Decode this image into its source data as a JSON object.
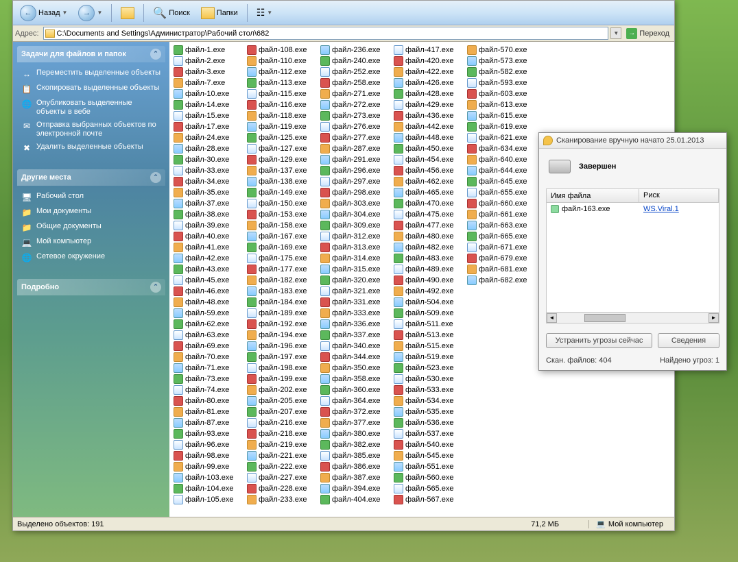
{
  "toolbar": {
    "back_label": "Назад",
    "search_label": "Поиск",
    "folders_label": "Папки"
  },
  "addressbar": {
    "label": "Адрес:",
    "path": "C:\\Documents and Settings\\Администратор\\Рабочий стол\\682",
    "go_label": "Переход"
  },
  "sidebar": {
    "panels": [
      {
        "title": "Задачи для файлов и папок",
        "items": [
          {
            "icon": "↔",
            "text": "Переместить выделенные объекты"
          },
          {
            "icon": "📋",
            "text": "Скопировать выделенные объекты"
          },
          {
            "icon": "🌐",
            "text": "Опубликовать выделенные объекты в вебе"
          },
          {
            "icon": "✉",
            "text": "Отправка выбранных объектов по электронной почте"
          },
          {
            "icon": "✖",
            "text": "Удалить выделенные объекты"
          }
        ]
      },
      {
        "title": "Другие места",
        "items": [
          {
            "icon": "🖥",
            "text": "Рабочий стол"
          },
          {
            "icon": "📁",
            "text": "Мои документы"
          },
          {
            "icon": "📁",
            "text": "Общие документы"
          },
          {
            "icon": "💻",
            "text": "Мой компьютер"
          },
          {
            "icon": "🌐",
            "text": "Сетевое окружение"
          }
        ]
      },
      {
        "title": "Подробно",
        "items": []
      }
    ]
  },
  "files": [
    "файл-1.exe",
    "файл-2.exe",
    "файл-3.exe",
    "файл-7.exe",
    "файл-10.exe",
    "файл-14.exe",
    "файл-15.exe",
    "файл-17.exe",
    "файл-24.exe",
    "файл-28.exe",
    "файл-30.exe",
    "файл-33.exe",
    "файл-34.exe",
    "файл-35.exe",
    "файл-37.exe",
    "файл-38.exe",
    "файл-39.exe",
    "файл-40.exe",
    "файл-41.exe",
    "файл-42.exe",
    "файл-43.exe",
    "файл-45.exe",
    "файл-46.exe",
    "файл-48.exe",
    "файл-59.exe",
    "файл-62.exe",
    "файл-63.exe",
    "файл-69.exe",
    "файл-70.exe",
    "файл-71.exe",
    "файл-73.exe",
    "файл-74.exe",
    "файл-80.exe",
    "файл-81.exe",
    "файл-87.exe",
    "файл-93.exe",
    "файл-96.exe",
    "файл-98.exe",
    "файл-99.exe",
    "файл-103.exe",
    "файл-104.exe",
    "файл-105.exe",
    "файл-108.exe",
    "файл-110.exe",
    "файл-112.exe",
    "файл-113.exe",
    "файл-115.exe",
    "файл-116.exe",
    "файл-118.exe",
    "файл-119.exe",
    "файл-125.exe",
    "файл-127.exe",
    "файл-129.exe",
    "файл-137.exe",
    "файл-138.exe",
    "файл-149.exe",
    "файл-150.exe",
    "файл-153.exe",
    "файл-158.exe",
    "файл-167.exe",
    "файл-169.exe",
    "файл-175.exe",
    "файл-177.exe",
    "файл-182.exe",
    "файл-183.exe",
    "файл-184.exe",
    "файл-189.exe",
    "файл-192.exe",
    "файл-194.exe",
    "файл-196.exe",
    "файл-197.exe",
    "файл-198.exe",
    "файл-199.exe",
    "файл-202.exe",
    "файл-205.exe",
    "файл-207.exe",
    "файл-216.exe",
    "файл-218.exe",
    "файл-219.exe",
    "файл-221.exe",
    "файл-222.exe",
    "файл-227.exe",
    "файл-228.exe",
    "файл-233.exe",
    "файл-236.exe",
    "файл-240.exe",
    "файл-252.exe",
    "файл-258.exe",
    "файл-271.exe",
    "файл-272.exe",
    "файл-273.exe",
    "файл-276.exe",
    "файл-277.exe",
    "файл-287.exe",
    "файл-291.exe",
    "файл-296.exe",
    "файл-297.exe",
    "файл-298.exe",
    "файл-303.exe",
    "файл-304.exe",
    "файл-309.exe",
    "файл-312.exe",
    "файл-313.exe",
    "файл-314.exe",
    "файл-315.exe",
    "файл-320.exe",
    "файл-321.exe",
    "файл-331.exe",
    "файл-333.exe",
    "файл-336.exe",
    "файл-337.exe",
    "файл-340.exe",
    "файл-344.exe",
    "файл-350.exe",
    "файл-358.exe",
    "файл-360.exe",
    "файл-364.exe",
    "файл-372.exe",
    "файл-377.exe",
    "файл-380.exe",
    "файл-382.exe",
    "файл-385.exe",
    "файл-386.exe",
    "файл-387.exe",
    "файл-394.exe",
    "файл-404.exe",
    "файл-417.exe",
    "файл-420.exe",
    "файл-422.exe",
    "файл-426.exe",
    "файл-428.exe",
    "файл-429.exe",
    "файл-436.exe",
    "файл-442.exe",
    "файл-448.exe",
    "файл-450.exe",
    "файл-454.exe",
    "файл-456.exe",
    "файл-462.exe",
    "файл-465.exe",
    "файл-470.exe",
    "файл-475.exe",
    "файл-477.exe",
    "файл-480.exe",
    "файл-482.exe",
    "файл-483.exe",
    "файл-489.exe",
    "файл-490.exe",
    "файл-492.exe",
    "файл-504.exe",
    "файл-509.exe",
    "файл-511.exe",
    "файл-513.exe",
    "файл-515.exe",
    "файл-519.exe",
    "файл-523.exe",
    "файл-530.exe",
    "файл-533.exe",
    "файл-534.exe",
    "файл-535.exe",
    "файл-536.exe",
    "файл-537.exe",
    "файл-540.exe",
    "файл-545.exe",
    "файл-551.exe",
    "файл-560.exe",
    "файл-565.exe",
    "файл-567.exe",
    "файл-570.exe",
    "файл-573.exe",
    "файл-582.exe",
    "файл-593.exe",
    "файл-603.exe",
    "файл-613.exe",
    "файл-615.exe",
    "файл-619.exe",
    "файл-621.exe",
    "файл-634.exe",
    "файл-640.exe",
    "файл-644.exe",
    "файл-645.exe",
    "файл-655.exe",
    "файл-660.exe",
    "файл-661.exe",
    "файл-663.exe",
    "файл-665.exe",
    "файл-671.exe",
    "файл-679.exe",
    "файл-681.exe",
    "файл-682.exe"
  ],
  "statusbar": {
    "selected": "Выделено объектов: 191",
    "size": "71,2 МБ",
    "location": "Мой компьютер"
  },
  "scanner": {
    "title": "Сканирование вручную начато 25.01.2013",
    "status": "Завершен",
    "columns": {
      "name": "Имя файла",
      "risk": "Риск"
    },
    "rows": [
      {
        "name": "файл-163.exe",
        "risk": "WS.Viral.1"
      }
    ],
    "buttons": {
      "fix": "Устранить угрозы сейчас",
      "details": "Сведения"
    },
    "footer": {
      "scanned": "Скан. файлов: 404",
      "found": "Найдено угроз: 1"
    }
  }
}
